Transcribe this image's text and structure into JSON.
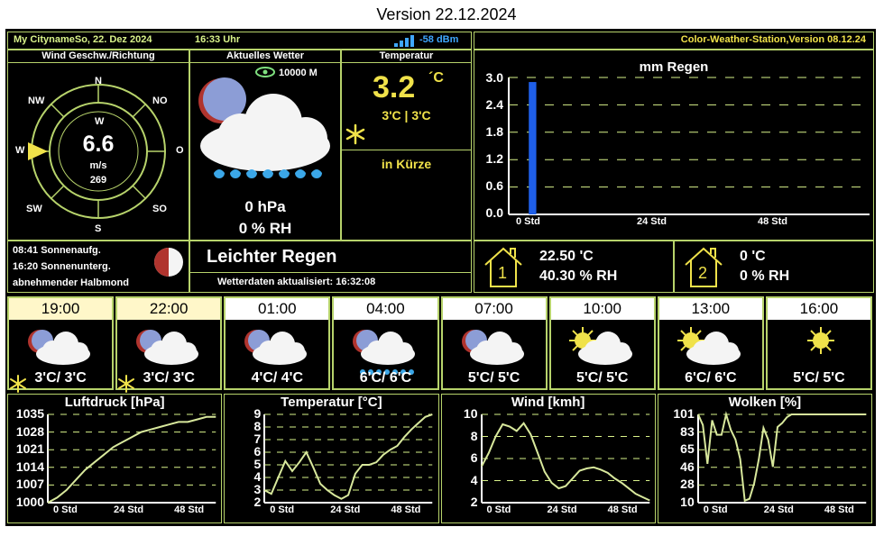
{
  "page_title": "Version 22.12.2024",
  "header": {
    "left": "My CitynameSo, 22. Dez 2024",
    "time": "16:33 Uhr",
    "signal": "-58 dBm",
    "right": "Color-Weather-Station,Version 08.12.24"
  },
  "wind": {
    "title": "Wind Geschw./Richtung",
    "compass": {
      "n": "N",
      "no": "NO",
      "o": "O",
      "so": "SO",
      "s": "S",
      "sw": "SW",
      "w": "W",
      "nw": "NW",
      "inner_w": "W"
    },
    "speed": "6.6",
    "unit": "m/s",
    "degrees": "269"
  },
  "current": {
    "title": "Aktuelles Wetter",
    "visibility": "10000 M",
    "pressure": "0 hPa",
    "humidity": "0 % RH",
    "condition": "Leichter Regen",
    "updated": "Wetterdaten aktualisiert: 16:32:08"
  },
  "temperature": {
    "title": "Temperatur",
    "value": "3.2",
    "unit": "´C",
    "minmax": "3'C | 3'C",
    "soon": "in Kürze"
  },
  "sun": {
    "sunrise": "08:41 Sonnenaufg.",
    "sunset": "16:20 Sonnenunterg.",
    "moon": "abnehmender Halbmond"
  },
  "rain_chart": {
    "title": "mm Regen",
    "y_ticks": [
      "3.0",
      "2.4",
      "1.8",
      "1.2",
      "0.6",
      "0.0"
    ],
    "x_ticks": [
      "0 Std",
      "24 Std",
      "48 Std"
    ]
  },
  "rooms": [
    {
      "num": "1",
      "temp": "22.50 'C",
      "hum": "40.30 % RH"
    },
    {
      "num": "2",
      "temp": "0 'C",
      "hum": "0 % RH"
    }
  ],
  "forecast": [
    {
      "time": "19:00",
      "temp": "3'C/ 3'C",
      "icon": "moon-cloud-icon",
      "snow": true,
      "rain": false,
      "highlight": true
    },
    {
      "time": "22:00",
      "temp": "3'C/ 3'C",
      "icon": "moon-cloud-icon",
      "snow": true,
      "rain": false,
      "highlight": true
    },
    {
      "time": "01:00",
      "temp": "4'C/ 4'C",
      "icon": "moon-cloud-icon",
      "snow": false,
      "rain": false,
      "highlight": false
    },
    {
      "time": "04:00",
      "temp": "6'C/ 6'C",
      "icon": "moon-cloud-rain-icon",
      "snow": false,
      "rain": true,
      "highlight": false
    },
    {
      "time": "07:00",
      "temp": "5'C/ 5'C",
      "icon": "moon-cloud-icon",
      "snow": false,
      "rain": false,
      "highlight": false
    },
    {
      "time": "10:00",
      "temp": "5'C/ 5'C",
      "icon": "sun-cloud-icon",
      "snow": false,
      "rain": false,
      "highlight": false
    },
    {
      "time": "13:00",
      "temp": "6'C/ 6'C",
      "icon": "sun-cloud-icon",
      "snow": false,
      "rain": false,
      "highlight": false
    },
    {
      "time": "16:00",
      "temp": "5'C/ 5'C",
      "icon": "sun-icon",
      "snow": false,
      "rain": false,
      "highlight": false
    }
  ],
  "colors": {
    "frame": "#b7d36b",
    "accent": "#f0e24a",
    "bar": "#1f5fe8",
    "line": "#d8e89c"
  },
  "chart_data": [
    {
      "type": "bar",
      "title": "mm Regen",
      "x_ticks": [
        "0 Std",
        "24 Std",
        "48 Std"
      ],
      "ylim": [
        0,
        3.0
      ],
      "x_range": [
        0,
        72
      ],
      "bars": [
        {
          "x": 4,
          "width": 1.5,
          "value": 2.9
        }
      ]
    },
    {
      "type": "line",
      "title": "Luftdruck [hPa]",
      "y_ticks": [
        "1035",
        "1028",
        "1021",
        "1014",
        "1007",
        "1000"
      ],
      "x_ticks": [
        "0 Std",
        "24 Std",
        "48 Std"
      ],
      "ylim": [
        1000,
        1035
      ],
      "x_range": [
        0,
        72
      ],
      "x": [
        0,
        4,
        8,
        12,
        16,
        20,
        24,
        28,
        32,
        36,
        40,
        44,
        48,
        52,
        56,
        60,
        64,
        68,
        72
      ],
      "y": [
        1000,
        1002,
        1005,
        1009,
        1013,
        1016,
        1019,
        1022,
        1024,
        1026,
        1028,
        1029,
        1030,
        1031,
        1032,
        1032,
        1033,
        1034,
        1034
      ]
    },
    {
      "type": "line",
      "title": "Temperatur [°C]",
      "y_ticks": [
        "9",
        "8",
        "7",
        "6",
        "5",
        "4",
        "3",
        "2"
      ],
      "x_ticks": [
        "0 Std",
        "24 Std",
        "48 Std"
      ],
      "ylim": [
        2,
        9
      ],
      "x_range": [
        0,
        72
      ],
      "x": [
        0,
        3,
        6,
        9,
        12,
        15,
        18,
        21,
        24,
        27,
        30,
        33,
        36,
        39,
        42,
        45,
        48,
        51,
        54,
        57,
        60,
        63,
        66,
        69,
        72
      ],
      "y": [
        3,
        2.7,
        4,
        5.3,
        4.5,
        5.2,
        6,
        4.8,
        3.5,
        3,
        2.6,
        2.3,
        2.6,
        4.3,
        5,
        5,
        5.2,
        5.8,
        6.2,
        6.5,
        7.2,
        7.8,
        8.3,
        8.8,
        9
      ]
    },
    {
      "type": "line",
      "title": "Wind [kmh]",
      "y_ticks": [
        "10",
        "8",
        "6",
        "4",
        "2"
      ],
      "x_ticks": [
        "0 Std",
        "24 Std",
        "48 Std"
      ],
      "ylim": [
        2,
        10
      ],
      "x_range": [
        0,
        72
      ],
      "x": [
        0,
        3,
        6,
        9,
        12,
        15,
        18,
        21,
        24,
        27,
        30,
        33,
        36,
        39,
        42,
        45,
        48,
        51,
        54,
        57,
        60,
        63,
        66,
        69,
        72
      ],
      "y": [
        5.3,
        6.5,
        8,
        9.1,
        8.9,
        8.5,
        9.2,
        8.2,
        6.5,
        4.8,
        3.8,
        3.3,
        3.5,
        4.2,
        4.9,
        5.1,
        5.2,
        5.0,
        4.7,
        4.2,
        3.8,
        3.3,
        2.8,
        2.5,
        2.2
      ]
    },
    {
      "type": "line",
      "title": "Wolken [%]",
      "y_ticks": [
        "101",
        "83",
        "65",
        "46",
        "28",
        "10"
      ],
      "x_ticks": [
        "0 Std",
        "24 Std",
        "48 Std"
      ],
      "ylim": [
        10,
        101
      ],
      "x_range": [
        0,
        72
      ],
      "x": [
        0,
        2,
        4,
        6,
        8,
        10,
        12,
        14,
        16,
        18,
        20,
        22,
        24,
        26,
        28,
        30,
        32,
        34,
        36,
        38,
        40,
        42,
        44,
        46,
        48,
        52,
        56,
        60,
        64,
        68,
        72
      ],
      "y": [
        101,
        90,
        50,
        95,
        80,
        80,
        101,
        85,
        75,
        55,
        12,
        14,
        30,
        55,
        87,
        75,
        47,
        88,
        92,
        98,
        101,
        101,
        101,
        101,
        101,
        101,
        101,
        101,
        101,
        101,
        101
      ]
    }
  ]
}
